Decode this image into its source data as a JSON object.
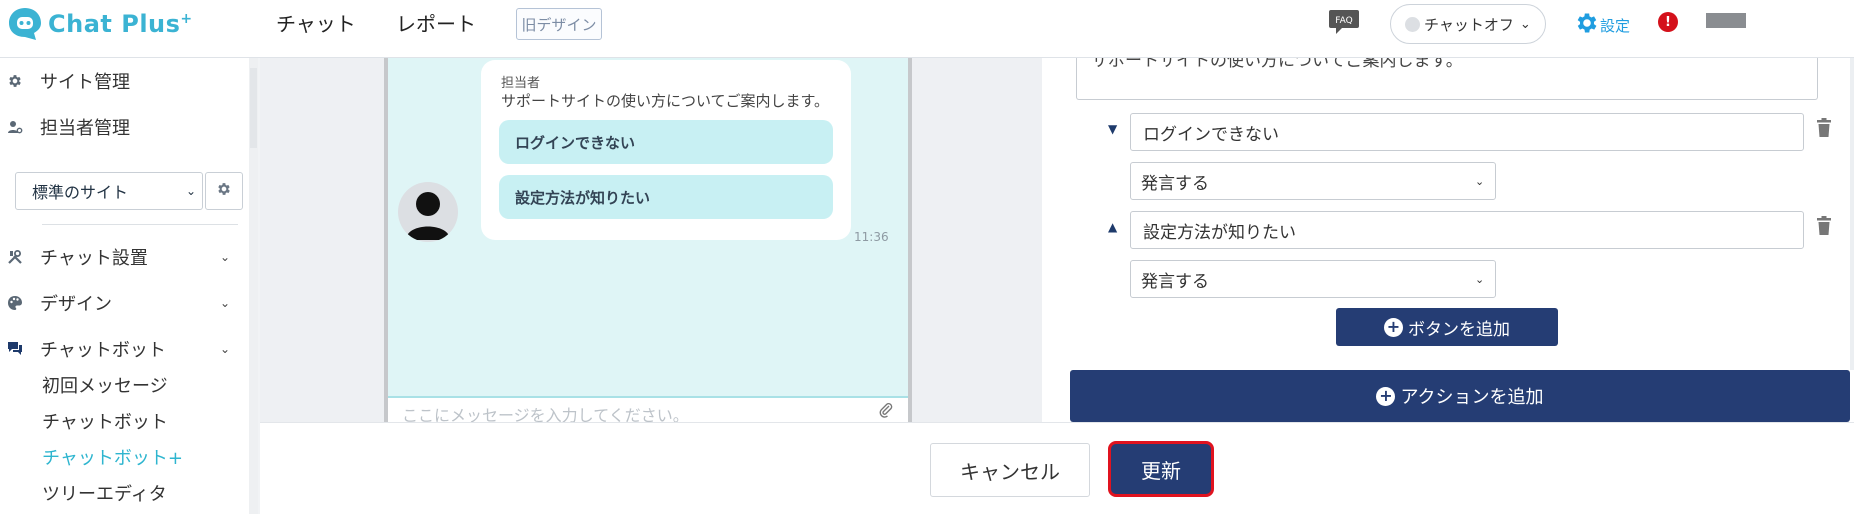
{
  "app": {
    "logo_text": "Chat Plus",
    "logo_sup": "+"
  },
  "topnav": {
    "chat": "チャット",
    "report": "レポート",
    "old_design": "旧デザイン"
  },
  "header": {
    "faq": "FAQ",
    "chat_status": "チャットオフ",
    "settings": "設定",
    "alert": "!"
  },
  "sidebar": {
    "site_admin": "サイト管理",
    "staff_admin": "担当者管理",
    "site_select": "標準のサイト",
    "chat_setup": "チャット設置",
    "design": "デザイン",
    "chatbot": "チャットボット",
    "sub_items": [
      "初回メッセージ",
      "チャットボット",
      "チャットボット+",
      "ツリーエディタ"
    ],
    "active_sub": "チャットボット+"
  },
  "preview": {
    "agent_label": "担当者",
    "message": "サポートサイトの使い方についてご案内します。",
    "buttons": [
      "ログインできない",
      "設定方法が知りたい"
    ],
    "time": "11:36",
    "input_placeholder": "ここにメッセージを入力してください。"
  },
  "editor": {
    "textarea_cut": "サポートサイトの使い方についてご案内します。",
    "rows": [
      {
        "label": "ログインできない",
        "action": "発言する"
      },
      {
        "label": "設定方法が知りたい",
        "action": "発言する"
      }
    ],
    "add_button": "ボタンを追加",
    "add_action": "アクションを追加"
  },
  "footer": {
    "cancel": "キャンセル",
    "update": "更新"
  },
  "colors": {
    "brand": "#3bb3d3",
    "navy": "#253d74",
    "accent_blue": "#1f9de0",
    "alert_red": "#d4111b"
  }
}
